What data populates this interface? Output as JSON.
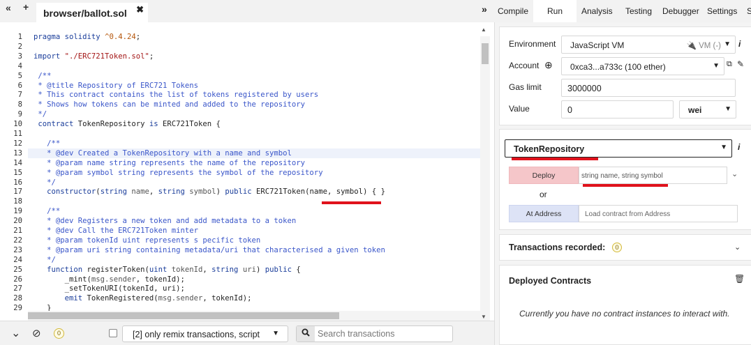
{
  "editor": {
    "file_tab": "browser/ballot.sol",
    "close_glyph": "✖",
    "toggle_left_glyph": "«",
    "new_file_glyph": "+",
    "expand_right_glyph": "»",
    "lines": [
      {
        "n": "1",
        "tokens": [
          [
            "key",
            "pragma solidity "
          ],
          [
            "num",
            "^0.4.24"
          ],
          [
            "plain",
            ";"
          ]
        ]
      },
      {
        "n": "2",
        "tokens": []
      },
      {
        "n": "3",
        "tokens": [
          [
            "key",
            "import "
          ],
          [
            "str",
            "\"./ERC721Token.sol\""
          ],
          [
            "plain",
            ";"
          ]
        ]
      },
      {
        "n": "4",
        "tokens": []
      },
      {
        "n": "5",
        "tokens": [
          [
            "com",
            " /**"
          ]
        ]
      },
      {
        "n": "6",
        "tokens": [
          [
            "com",
            " * @title Repository of ERC721 Tokens"
          ]
        ]
      },
      {
        "n": "7",
        "tokens": [
          [
            "com",
            " * This contract contains the list of tokens registered by users"
          ]
        ]
      },
      {
        "n": "8",
        "tokens": [
          [
            "com",
            " * Shows how tokens can be minted and added to the repository"
          ]
        ]
      },
      {
        "n": "9",
        "tokens": [
          [
            "com",
            " */"
          ]
        ]
      },
      {
        "n": "10",
        "tokens": [
          [
            "key",
            " contract "
          ],
          [
            "plain",
            "TokenRepository "
          ],
          [
            "key",
            "is "
          ],
          [
            "plain",
            "ERC721Token {"
          ]
        ]
      },
      {
        "n": "11",
        "tokens": []
      },
      {
        "n": "12",
        "tokens": [
          [
            "com",
            "   /**"
          ]
        ]
      },
      {
        "n": "13",
        "tokens": [
          [
            "com",
            "   * @dev Created a TokenRepository with a name and symbol"
          ]
        ]
      },
      {
        "n": "14",
        "tokens": [
          [
            "com",
            "   * @param name string represents the name of the repository"
          ]
        ]
      },
      {
        "n": "15",
        "tokens": [
          [
            "com",
            "   * @param symbol string represents the symbol of the repository"
          ]
        ]
      },
      {
        "n": "16",
        "tokens": [
          [
            "com",
            "   */"
          ]
        ]
      },
      {
        "n": "17",
        "tokens": [
          [
            "key",
            "   constructor"
          ],
          [
            "plain",
            "("
          ],
          [
            "key",
            "string "
          ],
          [
            "param",
            "name"
          ],
          [
            "plain",
            ", "
          ],
          [
            "key",
            "string "
          ],
          [
            "param",
            "symbol"
          ],
          [
            "plain",
            ") "
          ],
          [
            "key",
            "public "
          ],
          [
            "plain",
            "ERC721Token(name, symbol) { }"
          ]
        ]
      },
      {
        "n": "18",
        "tokens": []
      },
      {
        "n": "19",
        "tokens": [
          [
            "com",
            "   /**"
          ]
        ]
      },
      {
        "n": "20",
        "tokens": [
          [
            "com",
            "   * @dev Registers a new token and add metadata to a token"
          ]
        ]
      },
      {
        "n": "21",
        "tokens": [
          [
            "com",
            "   * @dev Call the ERC721Token minter"
          ]
        ]
      },
      {
        "n": "22",
        "tokens": [
          [
            "com",
            "   * @param tokenId uint represents s pecific token"
          ]
        ]
      },
      {
        "n": "23",
        "tokens": [
          [
            "com",
            "   * @param uri string containing metadata/uri that characterised a given token"
          ]
        ]
      },
      {
        "n": "24",
        "tokens": [
          [
            "com",
            "   */"
          ]
        ]
      },
      {
        "n": "25",
        "tokens": [
          [
            "key",
            "   function "
          ],
          [
            "plain",
            "registerToken("
          ],
          [
            "key",
            "uint "
          ],
          [
            "param",
            "tokenId"
          ],
          [
            "plain",
            ", "
          ],
          [
            "key",
            "string "
          ],
          [
            "param",
            "uri"
          ],
          [
            "plain",
            ") "
          ],
          [
            "key",
            "public "
          ],
          [
            "plain",
            "{"
          ]
        ]
      },
      {
        "n": "26",
        "tokens": [
          [
            "plain",
            "       _mint("
          ],
          [
            "param",
            "msg.sender"
          ],
          [
            "plain",
            ", tokenId);"
          ]
        ]
      },
      {
        "n": "27",
        "tokens": [
          [
            "plain",
            "       _setTokenURI(tokenId, uri);"
          ]
        ]
      },
      {
        "n": "28",
        "tokens": [
          [
            "key",
            "       emit "
          ],
          [
            "plain",
            "TokenRegistered("
          ],
          [
            "param",
            "msg.sender"
          ],
          [
            "plain",
            ", tokenId);"
          ]
        ]
      },
      {
        "n": "29",
        "tokens": [
          [
            "plain",
            "   }"
          ]
        ]
      }
    ]
  },
  "terminal": {
    "collapse_glyph": "⌄",
    "clear_glyph": "⊘",
    "pending_count": "0",
    "filter_label": "[2] only remix transactions, script",
    "search_placeholder": "Search transactions"
  },
  "right_panel": {
    "expand_glyph": "»",
    "tabs": [
      "Compile",
      "Run",
      "Analysis",
      "Testing",
      "Debugger",
      "Settings",
      "S"
    ],
    "active_tab": "Run",
    "environment_label": "Environment",
    "environment_value": "JavaScript VM",
    "environment_vm_tag": "VM (-)",
    "account_label": "Account",
    "account_value": "0xca3...a733c (100 ether)",
    "gas_limit_label": "Gas limit",
    "gas_limit_value": "3000000",
    "value_label": "Value",
    "value_amount": "0",
    "value_unit": "wei",
    "contract_selected": "TokenRepository",
    "deploy_label": "Deploy",
    "deploy_params": "string name, string symbol",
    "or_label": "or",
    "at_address_label": "At Address",
    "at_address_placeholder": "Load contract from Address",
    "transactions_label": "Transactions recorded:",
    "transactions_count": "0",
    "deployed_label": "Deployed Contracts",
    "empty_message": "Currently you have no contract instances to interact with."
  },
  "colors": {
    "annotation_red": "#e0121c",
    "deploy_bg": "#f5c6c9",
    "at_address_bg": "#dde3f6",
    "comment_blue": "#3a56c9",
    "keyword_blue": "#1a3d9a"
  }
}
